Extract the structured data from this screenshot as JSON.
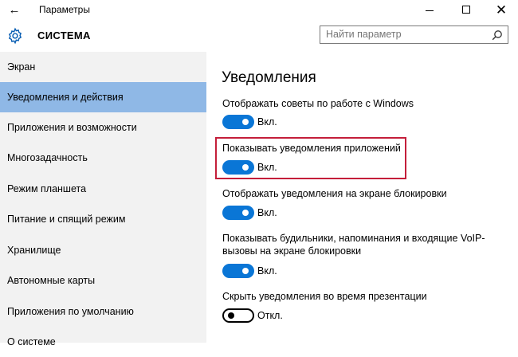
{
  "window": {
    "back_glyph": "←",
    "title": "Параметры",
    "close_glyph": "✕"
  },
  "header": {
    "app_title": "СИСТЕМА",
    "search_placeholder": "Найти параметр"
  },
  "sidebar": {
    "items": [
      {
        "label": "Экран",
        "active": false
      },
      {
        "label": "Уведомления и действия",
        "active": true
      },
      {
        "label": "Приложения и возможности",
        "active": false
      },
      {
        "label": "Многозадачность",
        "active": false
      },
      {
        "label": "Режим планшета",
        "active": false
      },
      {
        "label": "Питание и спящий режим",
        "active": false
      },
      {
        "label": "Хранилище",
        "active": false
      },
      {
        "label": "Автономные карты",
        "active": false
      },
      {
        "label": "Приложения по умолчанию",
        "active": false
      },
      {
        "label": "О системе",
        "active": false
      }
    ]
  },
  "main": {
    "section_title": "Уведомления",
    "settings": [
      {
        "label": "Отображать советы по работе с Windows",
        "state": "Вкл.",
        "on": true
      },
      {
        "label": "Показывать уведомления приложений",
        "state": "Вкл.",
        "on": true
      },
      {
        "label": "Отображать уведомления на экране блокировки",
        "state": "Вкл.",
        "on": true
      },
      {
        "label": "Показывать будильники, напоминания и входящие VoIP-вызовы на экране блокировки",
        "state": "Вкл.",
        "on": true
      },
      {
        "label": "Скрыть уведомления во время презентации",
        "state": "Откл.",
        "on": false
      }
    ]
  },
  "colors": {
    "accent": "#0a76d6",
    "sidebar_selected": "#8fb8e6",
    "sidebar_bg": "#f2f2f2",
    "highlight_border": "#c41e3a"
  }
}
